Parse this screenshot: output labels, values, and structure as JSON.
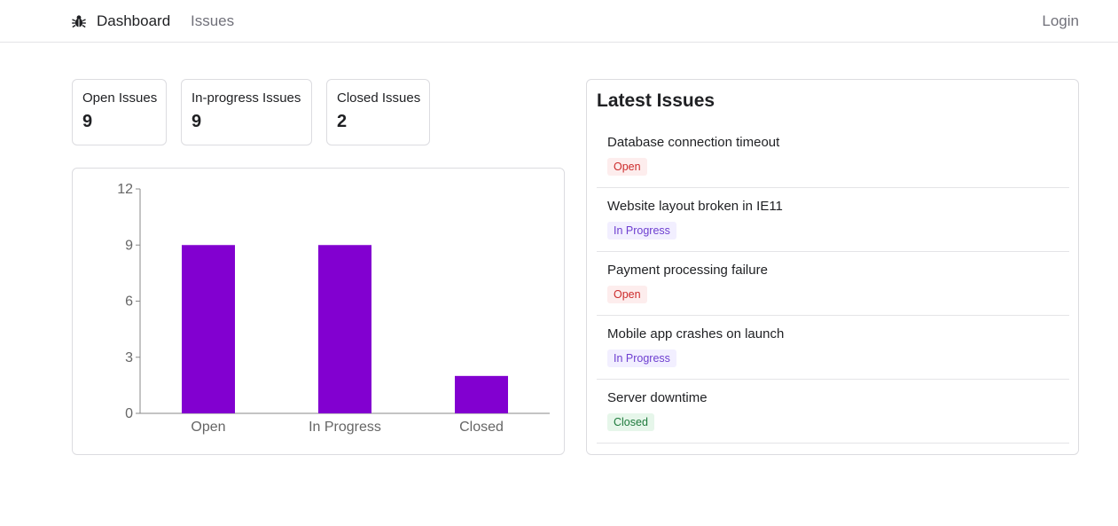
{
  "nav": {
    "logo_icon": "bug-icon",
    "dashboard_label": "Dashboard",
    "issues_label": "Issues",
    "login_label": "Login"
  },
  "stats": [
    {
      "label": "Open Issues",
      "value": "9"
    },
    {
      "label": "In-progress Issues",
      "value": "9"
    },
    {
      "label": "Closed Issues",
      "value": "2"
    }
  ],
  "chart_data": {
    "type": "bar",
    "categories": [
      "Open",
      "In Progress",
      "Closed"
    ],
    "values": [
      9,
      9,
      2
    ],
    "ylim": [
      0,
      12
    ],
    "yticks": [
      0,
      3,
      6,
      9,
      12
    ],
    "bar_color": "#8200d0",
    "title": "",
    "xlabel": "",
    "ylabel": "",
    "grid": false
  },
  "latest": {
    "title": "Latest Issues",
    "items": [
      {
        "title": "Database connection timeout",
        "status": "Open"
      },
      {
        "title": "Website layout broken in IE11",
        "status": "In Progress"
      },
      {
        "title": "Payment processing failure",
        "status": "Open"
      },
      {
        "title": "Mobile app crashes on launch",
        "status": "In Progress"
      },
      {
        "title": "Server downtime",
        "status": "Closed"
      }
    ]
  },
  "colors": {
    "open": "#cc2b2b",
    "in_progress": "#6e3fd0",
    "closed": "#1e7a3c",
    "bar": "#8200d0"
  }
}
